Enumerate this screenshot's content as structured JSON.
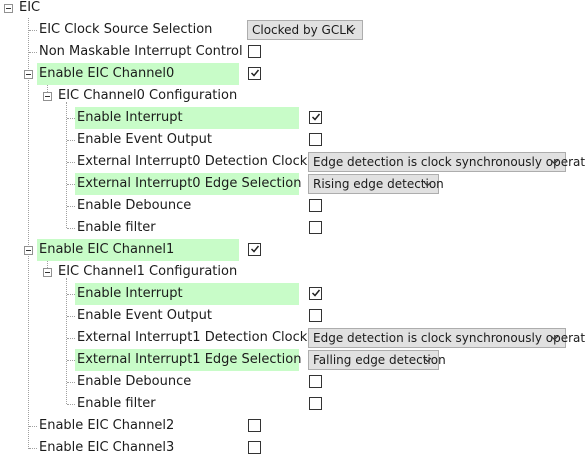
{
  "tree": {
    "root_label": "EIC",
    "clock_source_label": "EIC Clock Source Selection",
    "clock_source_value": "Clocked by GCLK",
    "nmi_label": "Non Maskable Interrupt Control",
    "nmi_checked": false,
    "channels": [
      {
        "enable_label": "Enable EIC Channel0",
        "enabled": true,
        "config_label": "EIC Channel0 Configuration",
        "enable_interrupt_label": "Enable Interrupt",
        "enable_interrupt_checked": true,
        "enable_event_label": "Enable Event Output",
        "enable_event_checked": false,
        "detection_clock_label": "External Interrupt0 Detection Clock",
        "detection_clock_value": "Edge detection is clock synchronously operated",
        "edge_selection_label": "External Interrupt0 Edge Selection",
        "edge_selection_value": "Rising edge detection",
        "debounce_label": "Enable Debounce",
        "debounce_checked": false,
        "filter_label": "Enable filter",
        "filter_checked": false
      },
      {
        "enable_label": "Enable EIC Channel1",
        "enabled": true,
        "config_label": "EIC Channel1 Configuration",
        "enable_interrupt_label": "Enable Interrupt",
        "enable_interrupt_checked": true,
        "enable_event_label": "Enable Event Output",
        "enable_event_checked": false,
        "detection_clock_label": "External Interrupt1 Detection Clock",
        "detection_clock_value": "Edge detection is clock synchronously operated",
        "edge_selection_label": "External Interrupt1 Edge Selection",
        "edge_selection_value": "Falling edge detection",
        "debounce_label": "Enable Debounce",
        "debounce_checked": false,
        "filter_label": "Enable filter",
        "filter_checked": false
      },
      {
        "enable_label": "Enable EIC Channel2",
        "enabled": false
      },
      {
        "enable_label": "Enable EIC Channel3",
        "enabled": false
      }
    ]
  },
  "colors": {
    "highlight": "#c8fcc8"
  }
}
